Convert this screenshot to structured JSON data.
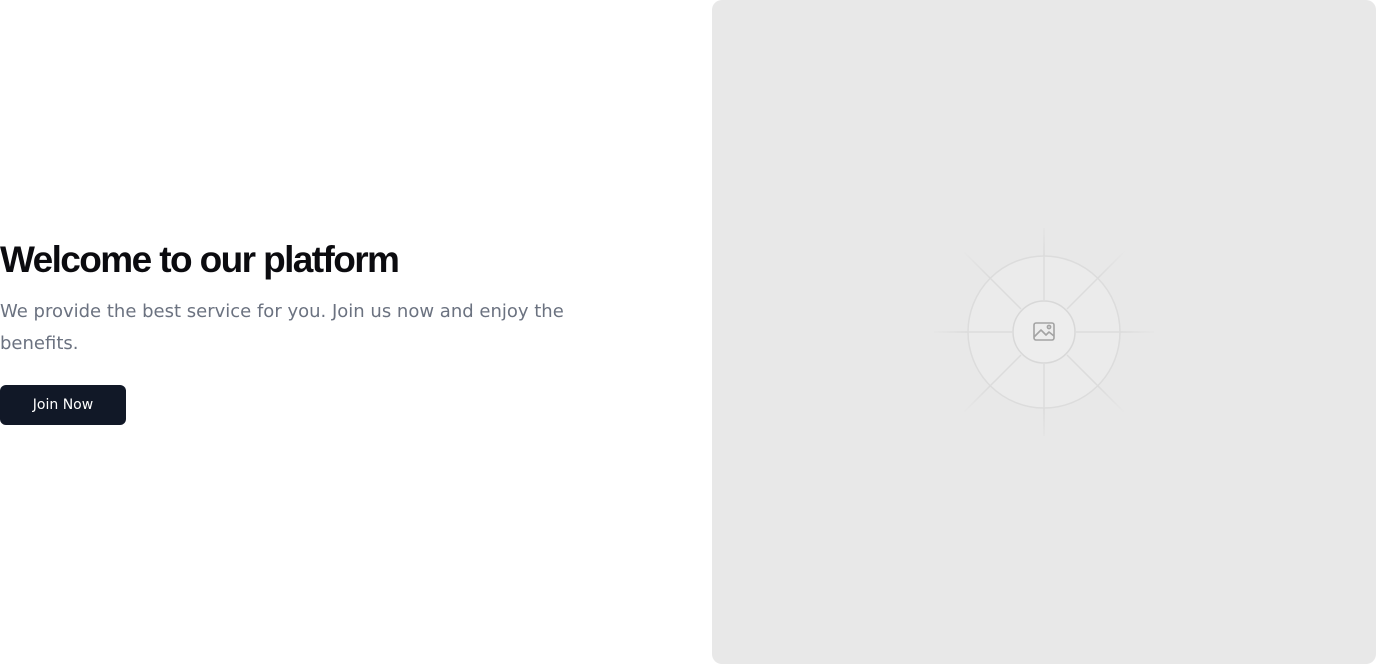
{
  "hero": {
    "title": "Welcome to our platform",
    "subtitle": "We provide the best service for you. Join us now and enjoy the benefits.",
    "cta_label": "Join Now"
  },
  "media": {
    "icon": "image-placeholder-icon"
  },
  "colors": {
    "title": "#0b0b0f",
    "subtitle": "#6b7280",
    "button_bg": "#111827",
    "button_text": "#ffffff",
    "media_bg": "#e8e8e8"
  }
}
